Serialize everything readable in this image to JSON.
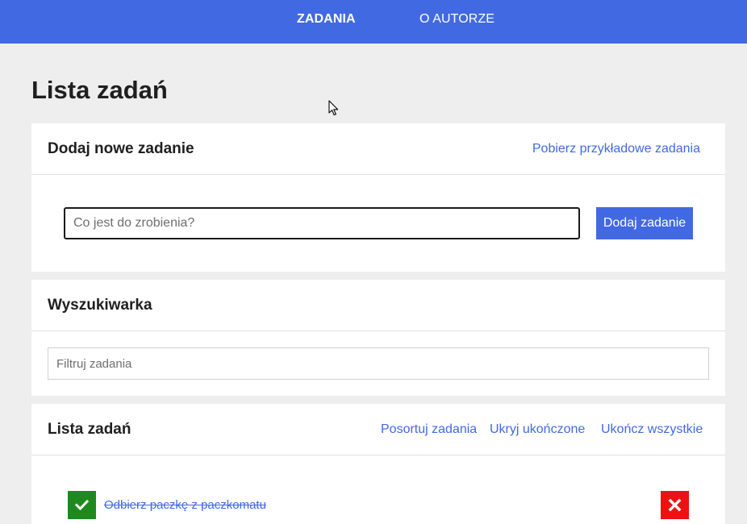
{
  "nav": {
    "items": [
      {
        "label": "ZADANIA",
        "active": true
      },
      {
        "label": "O AUTORZE",
        "active": false
      }
    ]
  },
  "page": {
    "title": "Lista zadań"
  },
  "add_card": {
    "title": "Dodaj nowe zadanie",
    "sample_link": "Pobierz przykładowe zadania",
    "input_placeholder": "Co jest do zrobienia?",
    "input_value": "",
    "add_button_label": "Dodaj zadanie"
  },
  "search_card": {
    "title": "Wyszukiwarka",
    "filter_placeholder": "Filtruj zadania",
    "filter_value": ""
  },
  "list_card": {
    "title": "Lista zadań",
    "actions": {
      "sort": "Posortuj zadania",
      "hide_completed": "Ukryj ukończone",
      "complete_all": "Ukończ wszystkie"
    },
    "tasks": [
      {
        "text": "Odbierz paczkę z paczkomatu",
        "completed": true
      }
    ]
  },
  "colors": {
    "primary": "#4169e1",
    "background": "#eeeeee",
    "card": "#ffffff",
    "done": "#1e8a1e",
    "delete": "#ee1111"
  },
  "icons": {
    "check": "check-icon",
    "delete": "close-icon",
    "cursor": "mouse-pointer-icon"
  }
}
